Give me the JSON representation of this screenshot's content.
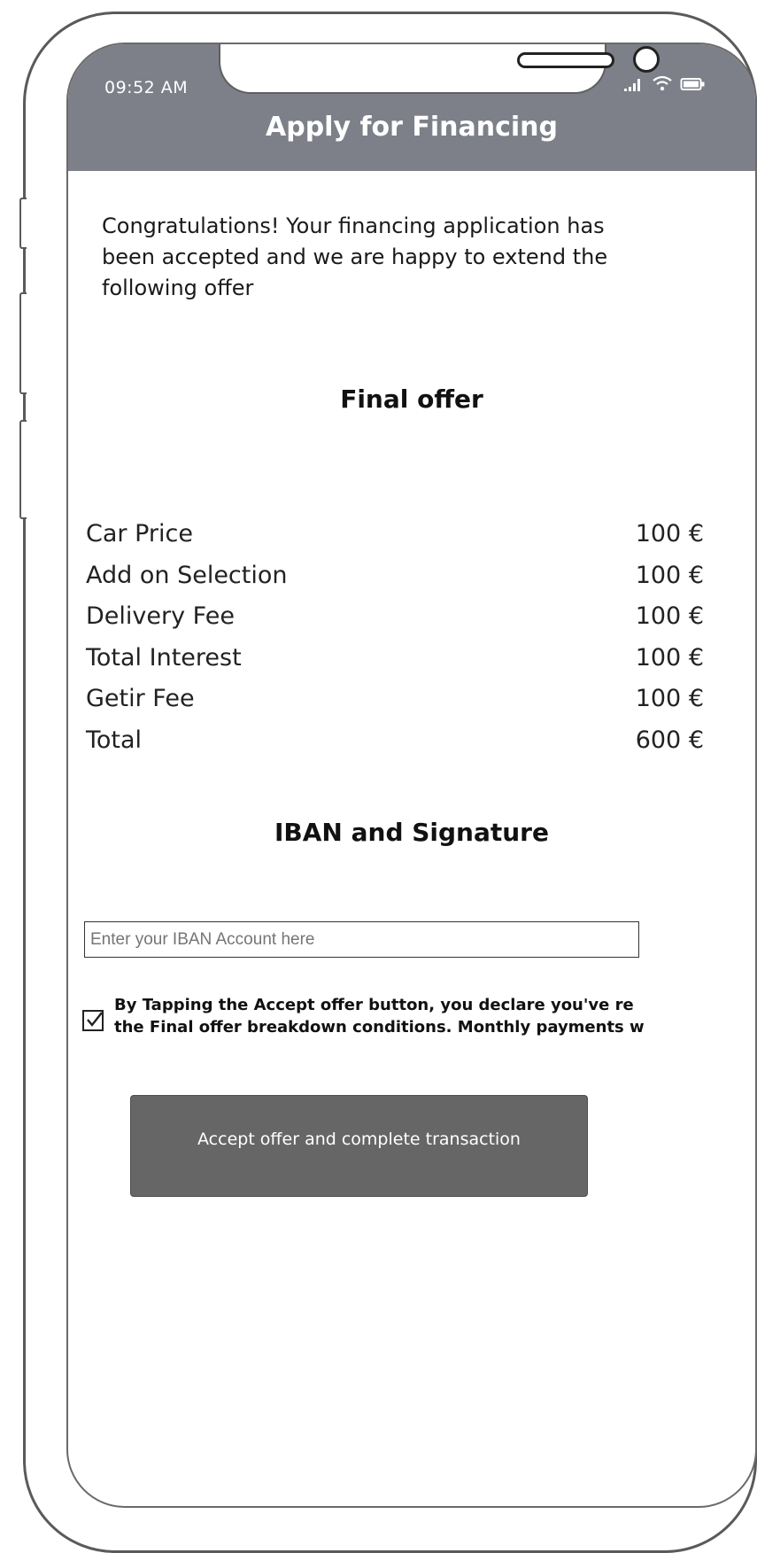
{
  "status_bar": {
    "time": "09:52 AM",
    "icons": [
      "signal-icon",
      "wifi-icon",
      "battery-icon"
    ]
  },
  "header": {
    "title": "Apply for Financing",
    "color": "#7d8089"
  },
  "intro": {
    "text": "Congratulations!  Your financing application has been accepted and we are happy to extend the following offer"
  },
  "final_offer": {
    "title": "Final offer",
    "rows": [
      {
        "label": "Car Price",
        "value": "100 €"
      },
      {
        "label": "Add on Selection",
        "value": "100 €"
      },
      {
        "label": "Delivery Fee",
        "value": "100 €"
      },
      {
        "label": "Total Interest",
        "value": "100 €"
      },
      {
        "label": "Getir Fee",
        "value": "100 €"
      },
      {
        "label": "Total",
        "value": "600 €"
      }
    ]
  },
  "iban": {
    "title": "IBAN and Signature",
    "placeholder": "Enter your IBAN Account here",
    "value": ""
  },
  "consent": {
    "checked": true,
    "line1": "By Tapping the Accept offer button, you declare you've re",
    "line2": "the Final offer breakdown conditions. Monthly payments w"
  },
  "actions": {
    "accept_label": "Accept offer and complete transaction",
    "accept_color": "#666666"
  }
}
